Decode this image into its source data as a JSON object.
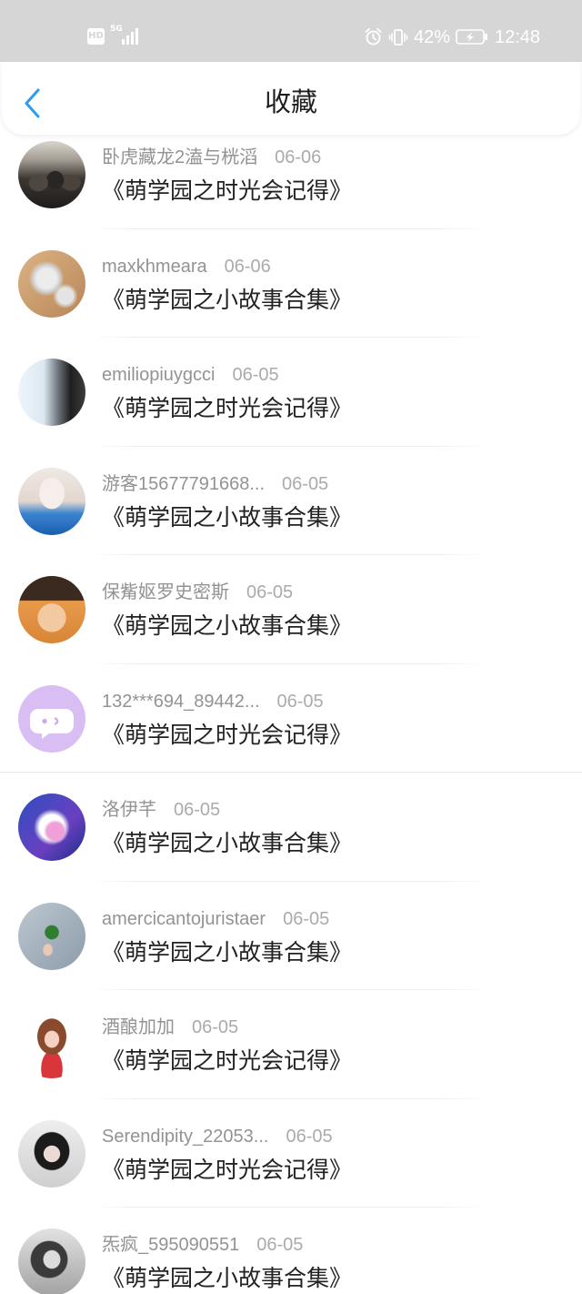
{
  "status_bar": {
    "hd_badge": "HD",
    "network_type": "5G",
    "battery_percent": "42%",
    "time": "12:48",
    "signal_icon": "signal-icon",
    "alarm_icon": "alarm-icon",
    "vibrate_icon": "vibrate-icon",
    "battery_icon": "battery-charging-icon"
  },
  "header": {
    "back_icon": "chevron-left-icon",
    "title": "收藏"
  },
  "colors": {
    "accent": "#2b9cf0",
    "status_bar_bg": "#d6d6d6",
    "title_text": "#222222",
    "meta_text": "#939393",
    "default_avatar_bg": "#d9bef3"
  },
  "list": {
    "items": [
      {
        "name": "卧虎藏龙2溘与桄滔",
        "date": "06-06",
        "title": "《萌学园之时光会记得》"
      },
      {
        "name": "maxkhmeara",
        "date": "06-06",
        "title": "《萌学园之小故事合集》"
      },
      {
        "name": "emiliopiuygcci",
        "date": "06-05",
        "title": "《萌学园之时光会记得》"
      },
      {
        "name": "游客15677791668...",
        "date": "06-05",
        "title": "《萌学园之小故事合集》"
      },
      {
        "name": "保觜妪罗史密斯",
        "date": "06-05",
        "title": "《萌学园之小故事合集》"
      },
      {
        "name": "132***694_89442...",
        "date": "06-05",
        "title": "《萌学园之时光会记得》"
      },
      {
        "name": "洛伊芊",
        "date": "06-05",
        "title": "《萌学园之小故事合集》"
      },
      {
        "name": "amercicantojuristaer",
        "date": "06-05",
        "title": "《萌学园之小故事合集》"
      },
      {
        "name": "酒酿加加",
        "date": "06-05",
        "title": "《萌学园之时光会记得》"
      },
      {
        "name": "Serendipity_22053...",
        "date": "06-05",
        "title": "《萌学园之时光会记得》"
      },
      {
        "name": "炁疯_595090551",
        "date": "06-05",
        "title": "《萌学园之小故事合集》"
      }
    ]
  }
}
